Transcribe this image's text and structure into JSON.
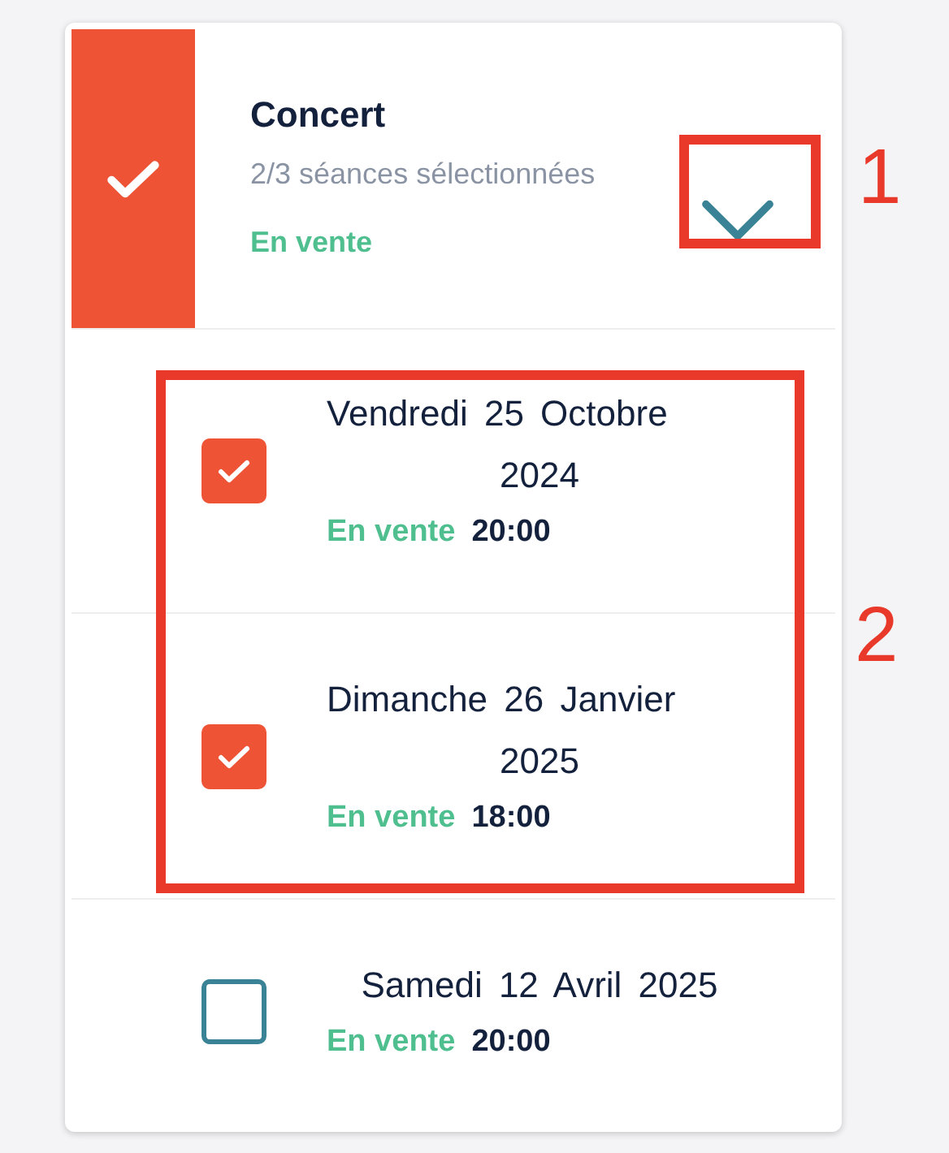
{
  "event": {
    "title": "Concert",
    "selected": true,
    "summary": "2/3 séances sélectionnées",
    "status": "En vente",
    "expanded": true
  },
  "sessions": [
    {
      "date": "Vendredi 25 Octobre 2024",
      "status": "En vente",
      "time": "20:00",
      "checked": true
    },
    {
      "date": "Dimanche 26 Janvier 2025",
      "status": "En vente",
      "time": "18:00",
      "checked": true
    },
    {
      "date": "Samedi 12 Avril 2025",
      "status": "En vente",
      "time": "20:00",
      "checked": false
    }
  ],
  "annotations": [
    {
      "label": "1"
    },
    {
      "label": "2"
    }
  ]
}
